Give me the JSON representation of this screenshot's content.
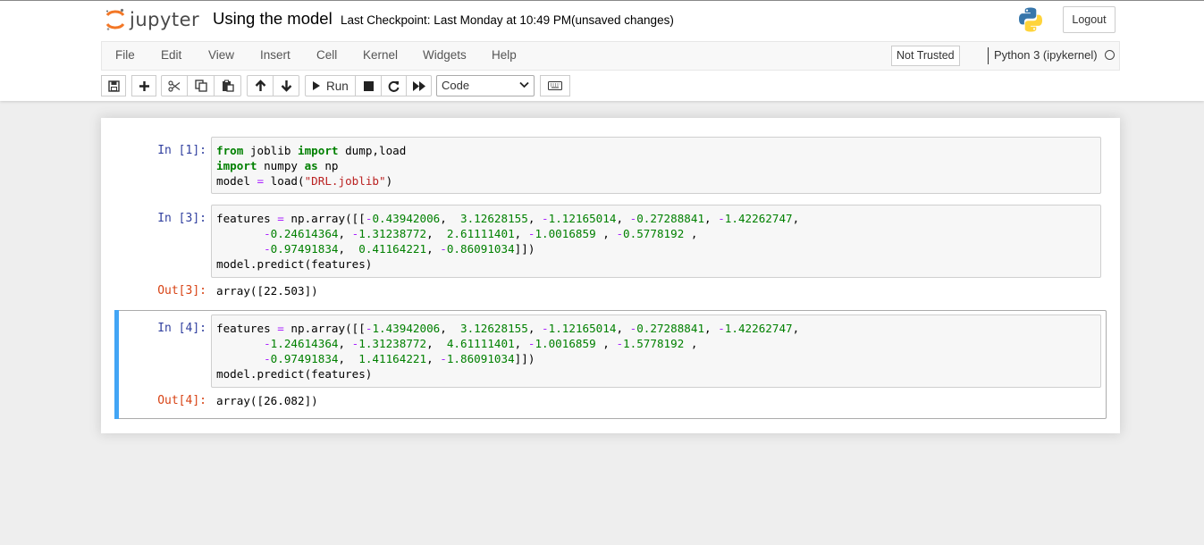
{
  "header": {
    "logo_text": "jupyter",
    "notebook_name": "Using the model",
    "checkpoint": "Last Checkpoint: Last Monday at 10:49 PM",
    "autosave_status": "(unsaved changes)",
    "logout_label": "Logout"
  },
  "menubar": {
    "items": [
      "File",
      "Edit",
      "View",
      "Insert",
      "Cell",
      "Kernel",
      "Widgets",
      "Help"
    ],
    "trusted_label": "Not Trusted",
    "kernel_name": "Python 3 (ipykernel)"
  },
  "toolbar": {
    "run_label": "Run",
    "cell_type": "Code",
    "icons": [
      "save-icon",
      "plus-icon",
      "cut-icon",
      "copy-icon",
      "paste-icon",
      "arrow-up-icon",
      "arrow-down-icon",
      "play-icon",
      "stop-icon",
      "restart-icon",
      "fast-forward-icon",
      "chevron-down-icon",
      "keyboard-icon"
    ]
  },
  "cells": [
    {
      "prompt": "In [1]:",
      "code_lines": [
        [
          [
            "kw",
            "from"
          ],
          [
            "",
            " joblib "
          ],
          [
            "kw",
            "import"
          ],
          [
            "",
            " dump,load"
          ]
        ],
        [
          [
            "kw",
            "import"
          ],
          [
            "",
            " numpy "
          ],
          [
            "kw",
            "as"
          ],
          [
            "",
            " np"
          ]
        ],
        [
          [
            "",
            "model "
          ],
          [
            "op",
            "="
          ],
          [
            "",
            " load("
          ],
          [
            "str",
            "\"DRL.joblib\""
          ],
          [
            "",
            ")"
          ]
        ]
      ]
    },
    {
      "prompt": "In [3]:",
      "code_lines": [
        [
          [
            "",
            "features "
          ],
          [
            "op",
            "="
          ],
          [
            "",
            " np.array([["
          ],
          [
            "op",
            "-"
          ],
          [
            "num",
            "0.43942006"
          ],
          [
            "",
            ",  "
          ],
          [
            "num",
            "3.12628155"
          ],
          [
            "",
            ", "
          ],
          [
            "op",
            "-"
          ],
          [
            "num",
            "1.12165014"
          ],
          [
            "",
            ", "
          ],
          [
            "op",
            "-"
          ],
          [
            "num",
            "0.27288841"
          ],
          [
            "",
            ", "
          ],
          [
            "op",
            "-"
          ],
          [
            "num",
            "1.42262747"
          ],
          [
            "",
            ","
          ]
        ],
        [
          [
            "",
            "       "
          ],
          [
            "op",
            "-"
          ],
          [
            "num",
            "0.24614364"
          ],
          [
            "",
            ", "
          ],
          [
            "op",
            "-"
          ],
          [
            "num",
            "1.31238772"
          ],
          [
            "",
            ",  "
          ],
          [
            "num",
            "2.61111401"
          ],
          [
            "",
            ", "
          ],
          [
            "op",
            "-"
          ],
          [
            "num",
            "1.0016859"
          ],
          [
            "",
            " , "
          ],
          [
            "op",
            "-"
          ],
          [
            "num",
            "0.5778192"
          ],
          [
            "",
            " ,"
          ]
        ],
        [
          [
            "",
            "       "
          ],
          [
            "op",
            "-"
          ],
          [
            "num",
            "0.97491834"
          ],
          [
            "",
            ",  "
          ],
          [
            "num",
            "0.41164221"
          ],
          [
            "",
            ", "
          ],
          [
            "op",
            "-"
          ],
          [
            "num",
            "0.86091034"
          ],
          [
            "",
            "]])"
          ]
        ],
        [
          [
            "",
            "model.predict(features)"
          ]
        ]
      ],
      "out_prompt": "Out[3]:",
      "output": "array([22.503])"
    },
    {
      "prompt": "In [4]:",
      "code_lines": [
        [
          [
            "",
            "features "
          ],
          [
            "op",
            "="
          ],
          [
            "",
            " np.array([["
          ],
          [
            "op",
            "-"
          ],
          [
            "num",
            "1.43942006"
          ],
          [
            "",
            ",  "
          ],
          [
            "num",
            "3.12628155"
          ],
          [
            "",
            ", "
          ],
          [
            "op",
            "-"
          ],
          [
            "num",
            "1.12165014"
          ],
          [
            "",
            ", "
          ],
          [
            "op",
            "-"
          ],
          [
            "num",
            "0.27288841"
          ],
          [
            "",
            ", "
          ],
          [
            "op",
            "-"
          ],
          [
            "num",
            "1.42262747"
          ],
          [
            "",
            ","
          ]
        ],
        [
          [
            "",
            "       "
          ],
          [
            "op",
            "-"
          ],
          [
            "num",
            "1.24614364"
          ],
          [
            "",
            ", "
          ],
          [
            "op",
            "-"
          ],
          [
            "num",
            "1.31238772"
          ],
          [
            "",
            ",  "
          ],
          [
            "num",
            "4.61111401"
          ],
          [
            "",
            ", "
          ],
          [
            "op",
            "-"
          ],
          [
            "num",
            "1.0016859"
          ],
          [
            "",
            " , "
          ],
          [
            "op",
            "-"
          ],
          [
            "num",
            "1.5778192"
          ],
          [
            "",
            " ,"
          ]
        ],
        [
          [
            "",
            "       "
          ],
          [
            "op",
            "-"
          ],
          [
            "num",
            "0.97491834"
          ],
          [
            "",
            ",  "
          ],
          [
            "num",
            "1.41164221"
          ],
          [
            "",
            ", "
          ],
          [
            "op",
            "-"
          ],
          [
            "num",
            "1.86091034"
          ],
          [
            "",
            "]])"
          ]
        ],
        [
          [
            "",
            "model.predict(features)"
          ]
        ]
      ],
      "out_prompt": "Out[4]:",
      "output": "array([26.082])"
    }
  ],
  "colors": {
    "keyword": "#008000",
    "operator": "#AA22FF",
    "number": "#008000",
    "string": "#BA2121",
    "in_prompt": "#303F9F",
    "out_prompt": "#D84315",
    "selected_cell": "#42A5F5"
  }
}
